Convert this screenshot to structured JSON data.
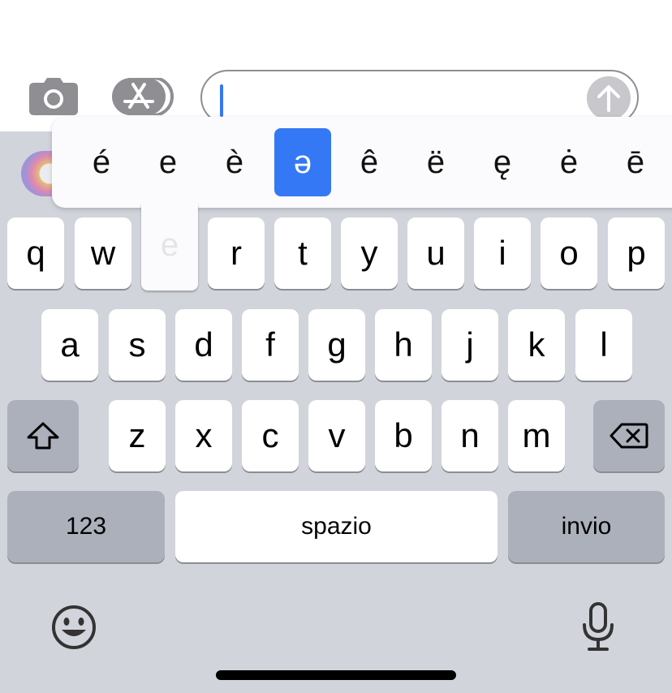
{
  "toolbar": {
    "camera_icon": "camera-icon",
    "appstore_icon": "app-store-icon",
    "input_value": "",
    "send_icon": "arrow-up-icon"
  },
  "accent_popup": {
    "options": [
      "é",
      "e",
      "è",
      "ə",
      "ê",
      "ë",
      "ę",
      "ė",
      "ē"
    ],
    "selected": "ə",
    "highlight_color": "#3478f6"
  },
  "keyboard": {
    "row1": [
      "q",
      "w",
      "e",
      "r",
      "t",
      "y",
      "u",
      "i",
      "o",
      "p"
    ],
    "row2": [
      "a",
      "s",
      "d",
      "f",
      "g",
      "h",
      "j",
      "k",
      "l"
    ],
    "row3": [
      "z",
      "x",
      "c",
      "v",
      "b",
      "n",
      "m"
    ],
    "pressed_key": "e",
    "numbers_label": "123",
    "space_label": "spazio",
    "return_label": "invio",
    "shift_icon": "shift-icon",
    "delete_icon": "delete-icon",
    "emoji_icon": "emoji-icon",
    "mic_icon": "microphone-icon"
  }
}
